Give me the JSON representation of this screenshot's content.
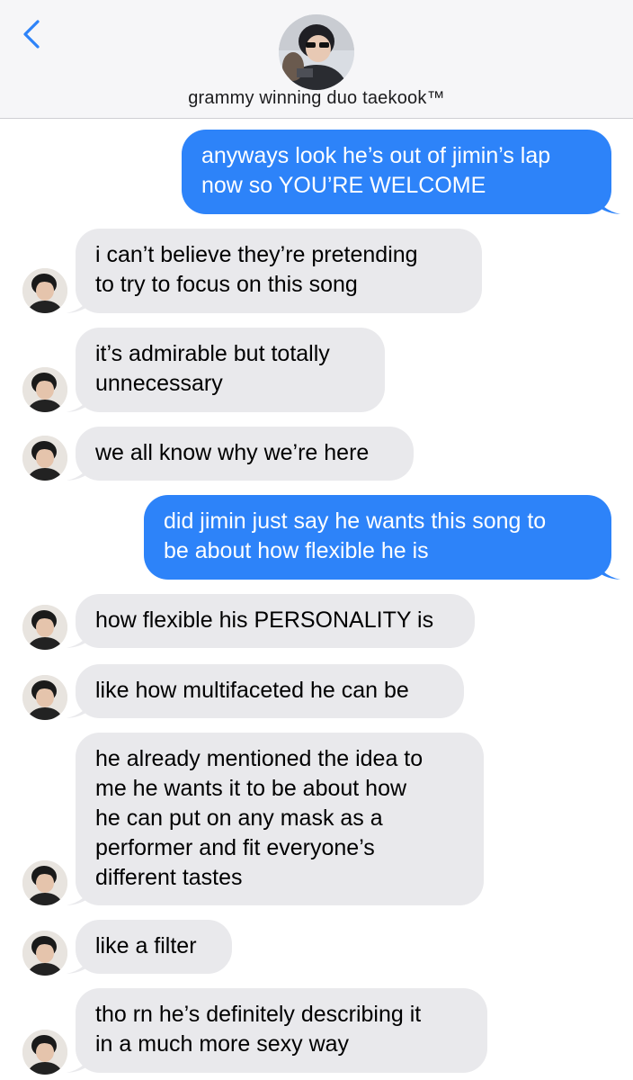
{
  "header": {
    "title": "grammy winning duo taekook™",
    "back_icon": "chevron-left-icon",
    "accent": "#2d83f9"
  },
  "messages": [
    {
      "from": "me",
      "text": "anyways look he’s out of jimin’s lap\nnow so YOU’RE WELCOME"
    },
    {
      "from": "them",
      "text": "i can’t believe they’re pretending\nto try to focus on this song"
    },
    {
      "from": "them",
      "text": "it’s admirable but totally\nunnecessary"
    },
    {
      "from": "them",
      "text": "we all know why we’re here"
    },
    {
      "from": "me",
      "text": "did jimin just say he wants this song to\nbe about how flexible he is"
    },
    {
      "from": "them",
      "text": "how flexible his PERSONALITY is"
    },
    {
      "from": "them",
      "text": "like how multifaceted he can be"
    },
    {
      "from": "them",
      "text": "he already mentioned the idea to\nme he wants it to be about how\nhe can put on any mask as a\nperformer and fit everyone’s\ndifferent tastes"
    },
    {
      "from": "them",
      "text": "like a filter"
    },
    {
      "from": "them",
      "text": "tho rn he’s definitely describing it\nin a much more sexy way"
    }
  ],
  "colors": {
    "outgoing_bubble": "#2d83f9",
    "incoming_bubble": "#e9e9ec",
    "header_bg": "#f6f6f8"
  }
}
